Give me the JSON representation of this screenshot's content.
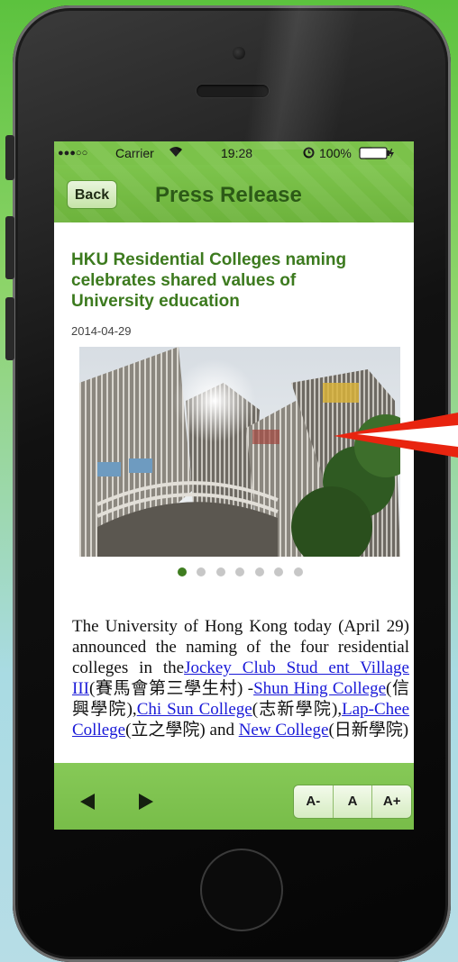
{
  "status_bar": {
    "signal": "●●●○○",
    "carrier": "Carrier",
    "wifi_icon": "wifi-icon",
    "time": "19:28",
    "alarm_icon": "alarm-icon",
    "battery": "100%",
    "battery_icon": "battery-icon"
  },
  "nav": {
    "back_label": "Back",
    "title": "Press Release"
  },
  "article": {
    "title": "HKU Residential Colleges naming celebrates shared values of University education",
    "date": "2014-04-29",
    "image_icon": "college-buildings-photo",
    "carousel": {
      "total": 7,
      "active": 1
    },
    "body": {
      "intro": "The University of Hong Kong today (April 29) announced the naming of the four residential colleges in the",
      "link1": "Jockey Club Stud ent Village III",
      "text1": "(賽馬會第三學生村) -",
      "link2": "Shun Hing College",
      "text2": "(信興學院),",
      "link3": "Chi Sun College",
      "text3": "(志新學院),",
      "link4": "Lap-Chee College",
      "text4": "(立之學院) and",
      "link5": "New College",
      "text5": "(日新學院)"
    }
  },
  "toolbar": {
    "prev_icon": "left-arrow-icon",
    "next_icon": "right-arrow-icon",
    "font_smaller": "A-",
    "font_normal": "A",
    "font_larger": "A+"
  },
  "colors": {
    "accent_green": "#7bc24a",
    "title_green": "#3c7a1e",
    "link_blue": "#1a1ad8",
    "annotation_red": "#e8240f"
  }
}
